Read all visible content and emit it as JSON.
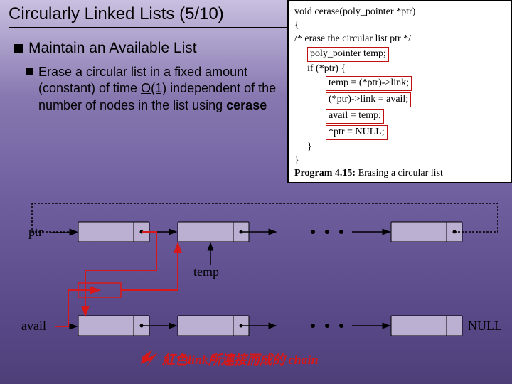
{
  "title": "Circularly Linked Lists (5/10)",
  "heading": "Maintain an Available List",
  "bullet_pre": "Erase a circular list in a fixed amount (constant) of time ",
  "bullet_u": "O(1)",
  "bullet_post": " independent of the number of nodes in the list using ",
  "bullet_bold": "cerase",
  "code": {
    "l1": "void cerase(poly_pointer *ptr)",
    "l2": "{",
    "l3": "/* erase the circular list ptr */",
    "b1": "poly_pointer temp;",
    "l4": "if (*ptr) {",
    "b2": "temp = (*ptr)->link;",
    "b3": "(*ptr)->link = avail;",
    "b4": "avail = temp;",
    "b5": "*ptr = NULL;",
    "l5": "}",
    "l6": "}"
  },
  "caption_b": "Program 4.15:",
  "caption_t": " Erasing a circular list",
  "labels": {
    "ptr": "ptr",
    "temp": "temp",
    "avail": "avail",
    "null": "NULL"
  },
  "footnote": "紅色link所連接而成的 chain"
}
